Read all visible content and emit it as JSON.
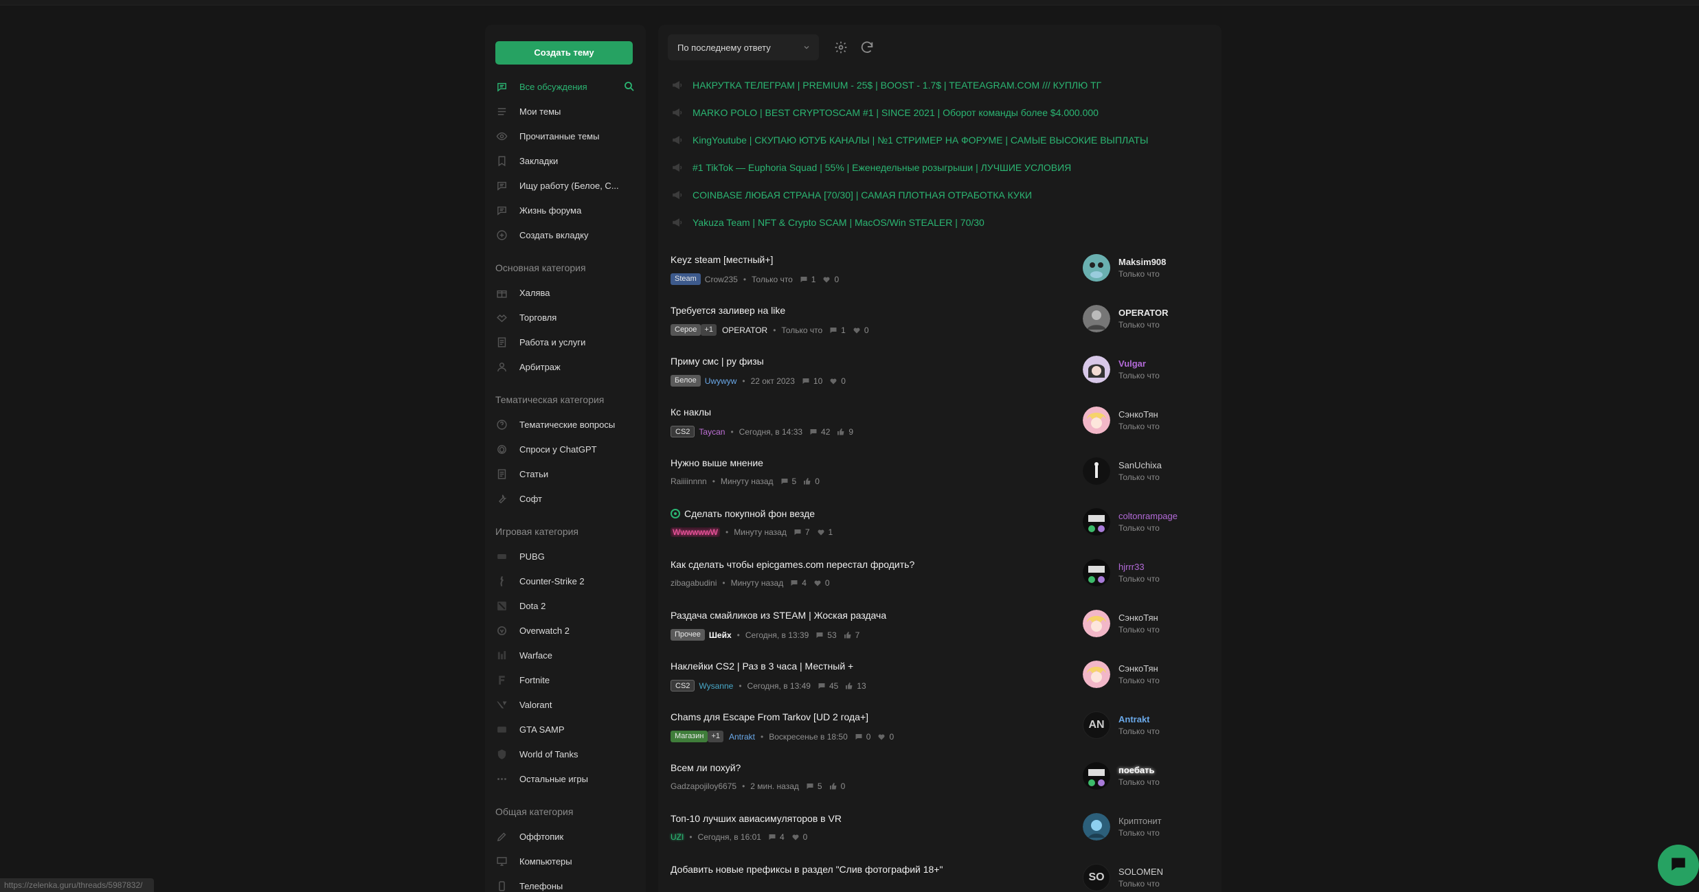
{
  "sidebar": {
    "create_label": "Создать тему",
    "items": [
      {
        "label": "Все обсуждения"
      },
      {
        "label": "Мои темы"
      },
      {
        "label": "Прочитанные темы"
      },
      {
        "label": "Закладки"
      },
      {
        "label": "Ищу работу (Белое, С..."
      },
      {
        "label": "Жизнь форума"
      },
      {
        "label": "Создать вкладку"
      }
    ],
    "categories": [
      {
        "title": "Основная категория",
        "items": [
          "Халява",
          "Торговля",
          "Работа и услуги",
          "Арбитраж"
        ]
      },
      {
        "title": "Тематическая категория",
        "items": [
          "Тематические вопросы",
          "Спроси у ChatGPT",
          "Статьи",
          "Софт"
        ]
      },
      {
        "title": "Игровая категория",
        "items": [
          "PUBG",
          "Counter-Strike 2",
          "Dota 2",
          "Overwatch 2",
          "Warface",
          "Fortnite",
          "Valorant",
          "GTA SAMP",
          "World of Tanks",
          "Остальные игры"
        ]
      },
      {
        "title": "Общая категория",
        "items": [
          "Оффтопик",
          "Компьютеры",
          "Телефоны"
        ]
      }
    ]
  },
  "toolbar": {
    "sort_value": "По последнему ответу"
  },
  "pinned": [
    "НАКРУТКА ТЕЛЕГРАМ | PREMIUM - 25$ | BOOST - 1.7$ | TEATEAGRAM.COM /// КУПЛЮ ТГ",
    "MARKO POLO | BEST CRYPTOSCAM #1 | SINCE 2021 | Оборот команды более $4.000.000",
    "KingYoutube | СКУПАЮ ЮТУБ КАНАЛЫ | №1 СТРИМЕР НА ФОРУМЕ | САМЫЕ ВЫСОКИЕ ВЫПЛАТЫ",
    "#1 TikTok — Euphoria Squad | 55% | Еженедельные розыгрыши | ЛУЧШИЕ УСЛОВИЯ",
    "COINBASE ЛЮБАЯ СТРАНА [70/30] | САМАЯ ПЛОТНАЯ ОТРАБОТКА КУКИ",
    "Yakuza Team | NFT & Crypto SCAM | MacOS/Win STEALER | 70/30"
  ],
  "threads": [
    {
      "title": "Keyz steam [местный+]",
      "prefix": "Steam",
      "plus": "",
      "author": "Crow235",
      "time": "Только что",
      "replies": "1",
      "likes": "0",
      "last_user": "Maksim908",
      "last_time": "Только что"
    },
    {
      "title": "Требуется заливер на like",
      "prefix": "Серое",
      "plus": "+1",
      "author": "OPERATOR",
      "time": "Только что",
      "replies": "1",
      "likes": "0",
      "last_user": "OPERATOR",
      "last_time": "Только что"
    },
    {
      "title": "Приму смс | ру физы",
      "prefix": "Белое",
      "plus": "",
      "author": "Uwywyw",
      "time": "22 окт 2023",
      "replies": "10",
      "likes": "0",
      "last_user": "Vulgar",
      "last_time": "Только что"
    },
    {
      "title": "Кс наклы",
      "prefix": "CS2",
      "plus": "",
      "author": "Taycan",
      "time": "Сегодня, в 14:33",
      "replies": "42",
      "likes": "9",
      "last_user": "СэнкоТян",
      "last_time": "Только что"
    },
    {
      "title": "Нужно выше мнение",
      "prefix": "",
      "plus": "",
      "author": "Raiiiinnnn",
      "time": "Минуту назад",
      "replies": "5",
      "likes": "0",
      "last_user": "SanUchixa",
      "last_time": "Только что"
    },
    {
      "title": "Сделать покупной фон везде",
      "prefix": "",
      "plus": "",
      "author": "WwwwwwW",
      "time": "Минуту назад",
      "replies": "7",
      "likes": "1",
      "last_user": "coltonrampage",
      "last_time": "Только что"
    },
    {
      "title": "Как сделать чтобы epicgames.com перестал фродить?",
      "prefix": "",
      "plus": "",
      "author": "zibagabudini",
      "time": "Минуту назад",
      "replies": "4",
      "likes": "0",
      "last_user": "hjrrr33",
      "last_time": "Только что"
    },
    {
      "title": "Раздача смайликов из STEAM | Жоская раздача",
      "prefix": "Прочее",
      "plus": "",
      "author": "Шейх",
      "time": "Сегодня, в 13:39",
      "replies": "53",
      "likes": "7",
      "last_user": "СэнкоТян",
      "last_time": "Только что"
    },
    {
      "title": "Наклейки CS2 | Раз в 3 часа | Местный +",
      "prefix": "CS2",
      "plus": "",
      "author": "Wysanne",
      "time": "Сегодня, в 13:49",
      "replies": "45",
      "likes": "13",
      "last_user": "СэнкоТян",
      "last_time": "Только что"
    },
    {
      "title": "Chams для Escape From Tarkov [UD 2 года+]",
      "prefix": "Магазин",
      "plus": "+1",
      "author": "Antrakt",
      "time": "Воскресенье в 18:50",
      "replies": "0",
      "likes": "0",
      "last_user": "Antrakt",
      "last_time": "Только что"
    },
    {
      "title": "Всем ли похуй?",
      "prefix": "",
      "plus": "",
      "author": "Gadzapojiloy6675",
      "time": "2 мин. назад",
      "replies": "5",
      "likes": "0",
      "last_user": "поебать",
      "last_time": "Только что"
    },
    {
      "title": "Топ-10 лучших авиасимуляторов в VR",
      "prefix": "",
      "plus": "",
      "author": "UZI",
      "time": "Сегодня, в 16:01",
      "replies": "4",
      "likes": "0",
      "last_user": "Криптонит",
      "last_time": "Только что"
    },
    {
      "title": "Добавить новые префиксы в раздел \"Слив фотографий 18+\"",
      "prefix": "",
      "plus": "",
      "author": "",
      "time": "",
      "replies": "",
      "likes": "",
      "last_user": "SOLOMEN",
      "last_time": "Только что"
    }
  ],
  "avatars": {
    "antrakt_initials": "AN",
    "solomen_initials": "SO"
  },
  "status_url": "https://zelenka.guru/threads/5987832/",
  "colors": {
    "accent": "#26a262",
    "pinned_text": "#2bb673",
    "bg": "#161616",
    "panel": "#1a1a1a"
  }
}
